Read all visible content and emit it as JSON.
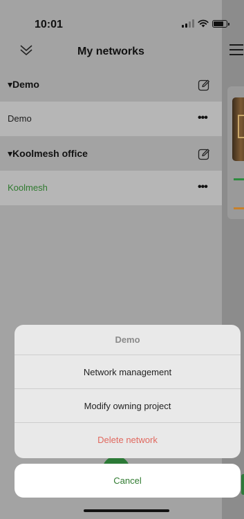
{
  "status_bar": {
    "time": "10:01"
  },
  "header": {
    "title": "My networks"
  },
  "groups": [
    {
      "title": "Demo",
      "networks": [
        {
          "name": "Demo",
          "selected": false
        }
      ]
    },
    {
      "title": "Koolmesh office",
      "networks": [
        {
          "name": "Koolmesh",
          "selected": true
        }
      ]
    }
  ],
  "action_sheet": {
    "title": "Demo",
    "items": [
      {
        "label": "Network management"
      },
      {
        "label": "Modify owning project"
      },
      {
        "label": "Delete network"
      }
    ],
    "cancel_label": "Cancel"
  },
  "colors": {
    "accent_green": "#2f7a2f",
    "danger": "#e0685e",
    "drawer_bg": "#a3a3a3",
    "row_bg": "#b6b6b6"
  }
}
